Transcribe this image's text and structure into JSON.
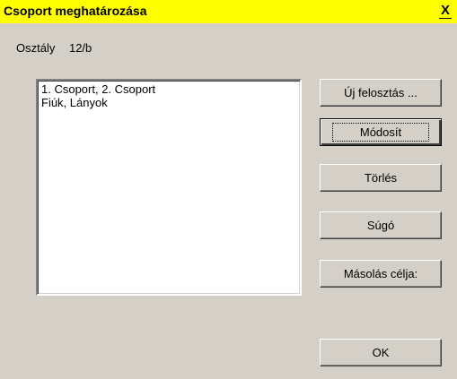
{
  "window": {
    "title": "Csoport meghatározása",
    "close_glyph": "X"
  },
  "class_row": {
    "label": "Osztály",
    "value": "12/b"
  },
  "groups_list": {
    "items": [
      "1. Csoport, 2. Csoport",
      "Fiúk, Lányok"
    ]
  },
  "buttons": {
    "new_split": "Új felosztás ...",
    "modify": "Módosít",
    "delete": "Törlés",
    "help": "Súgó",
    "copy_target": "Másolás célja:",
    "ok": "OK"
  },
  "colors": {
    "titlebar": "#ffff00",
    "dialog_bg": "#d4d0c8",
    "list_bg": "#ffffff"
  }
}
